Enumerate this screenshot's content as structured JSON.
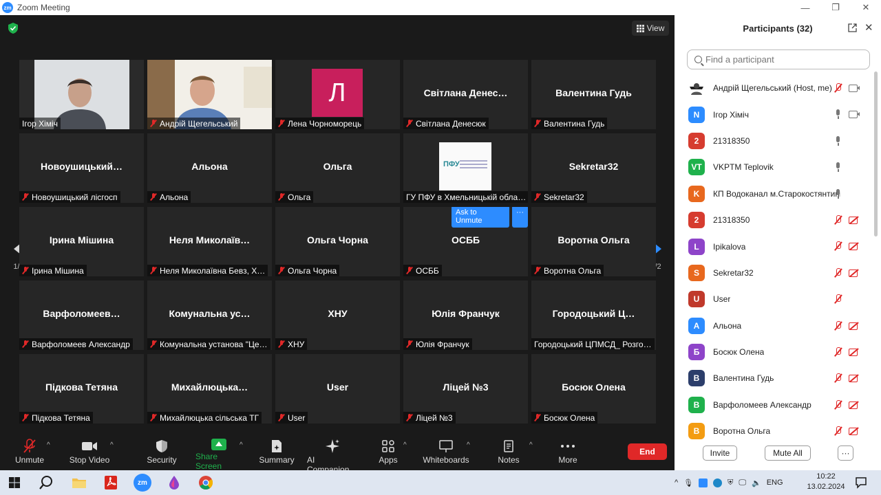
{
  "window": {
    "title": "Zoom Meeting",
    "logo_text": "zm",
    "controls": [
      "—",
      "❐",
      "✕"
    ]
  },
  "meeting": {
    "view_label": "View",
    "page_indicator": "1/2",
    "ask_to_unmute": "Ask to Unmute",
    "more_dots": "···",
    "tiles": [
      {
        "big": "",
        "name": "Ігор Хіміч",
        "kind": "video1",
        "muted": false,
        "active": true
      },
      {
        "big": "",
        "name": "Андрій Щегельський",
        "kind": "video2",
        "muted": true,
        "active": false
      },
      {
        "big": "",
        "name": "Лена Чорноморець",
        "kind": "avatar",
        "avatar": "Л",
        "muted": true
      },
      {
        "big": "Світлана  Денес…",
        "name": "Світлана Денесюк",
        "muted": true
      },
      {
        "big": "Валентина Гудь",
        "name": "Валентина Гудь",
        "muted": true
      },
      {
        "big": "Новоушицький…",
        "name": "Новоушицький лісгосп",
        "muted": true
      },
      {
        "big": "Альона",
        "name": "Альона",
        "muted": true
      },
      {
        "big": "Ольга",
        "name": "Ольга",
        "muted": true
      },
      {
        "big": "",
        "name": "ГУ ПФУ в Хмельницькій обла…",
        "kind": "pfu",
        "logo": "ПФУ",
        "muted": false
      },
      {
        "big": "Sekretar32",
        "name": "Sekretar32",
        "muted": true
      },
      {
        "big": "Ірина Мішина",
        "name": "Ірина Мішина",
        "muted": true
      },
      {
        "big": "Неля  Миколаїв…",
        "name": "Неля Миколаївна Бевз, Х…",
        "muted": true
      },
      {
        "big": "Ольга Чорна",
        "name": "Ольга Чорна",
        "muted": true
      },
      {
        "big": "ОСББ",
        "name": "ОСББ",
        "muted": true,
        "hover": true
      },
      {
        "big": "Воротна Ольга",
        "name": "Воротна Ольга",
        "muted": true
      },
      {
        "big": "Варфоломеев…",
        "name": "Варфоломеев Александр",
        "muted": true
      },
      {
        "big": "Комунальна  ус…",
        "name": "Комунальна установа \"Це…",
        "muted": true
      },
      {
        "big": "ХНУ",
        "name": "ХНУ",
        "muted": true
      },
      {
        "big": "Юлія Франчук",
        "name": "Юлія Франчук",
        "muted": true
      },
      {
        "big": "Городоцький  Ц…",
        "name": "Городоцький ЦПМСД_ Розго…",
        "muted": false
      },
      {
        "big": "Підкова Тетяна",
        "name": "Підкова Тетяна",
        "muted": true
      },
      {
        "big": "Михайлюцька…",
        "name": "Михайлюцька сільська ТГ",
        "muted": true
      },
      {
        "big": "User",
        "name": "User",
        "muted": true
      },
      {
        "big": "Ліцей №3",
        "name": "Ліцей №3",
        "muted": true
      },
      {
        "big": "Босюк Олена",
        "name": "Босюк Олена",
        "muted": true
      }
    ]
  },
  "toolbar": {
    "unmute": "Unmute",
    "stop_video": "Stop Video",
    "security": "Security",
    "share_screen": "Share Screen",
    "summary": "Summary",
    "ai_companion": "AI Companion",
    "apps": "Apps",
    "whiteboards": "Whiteboards",
    "notes": "Notes",
    "more": "More",
    "end": "End",
    "caret": "^",
    "share_color": "#1fb14c",
    "end_color": "#e02828"
  },
  "participants": {
    "title": "Participants (32)",
    "close": "✕",
    "search_placeholder": "Find a participant",
    "invite": "Invite",
    "mute_all": "Mute All",
    "more": "···",
    "list": [
      {
        "initial": "",
        "color": "#ffffff",
        "name": "Андрій Щегельський (Host, me)",
        "mic": "off",
        "cam": "on",
        "photo": true
      },
      {
        "initial": "N",
        "color": "#2d8cff",
        "name": "Ігор Хіміч",
        "mic": "on",
        "cam": "on"
      },
      {
        "initial": "2",
        "color": "#d63c2f",
        "name": "21318350",
        "mic": "on",
        "cam": "none"
      },
      {
        "initial": "VT",
        "color": "#1fb14c",
        "name": "VKPTM Teplovik",
        "mic": "on",
        "cam": "none"
      },
      {
        "initial": "K",
        "color": "#e8681e",
        "name": "КП Водоканал м.Старокостянтинів",
        "mic": "on",
        "cam": "none"
      },
      {
        "initial": "2",
        "color": "#d63c2f",
        "name": "21318350",
        "mic": "off",
        "cam": "off"
      },
      {
        "initial": "L",
        "color": "#8e44c9",
        "name": "Ipikalova",
        "mic": "off",
        "cam": "off"
      },
      {
        "initial": "S",
        "color": "#e8681e",
        "name": "Sekretar32",
        "mic": "off",
        "cam": "off"
      },
      {
        "initial": "U",
        "color": "#c0392b",
        "name": "User",
        "mic": "off",
        "cam": "none"
      },
      {
        "initial": "A",
        "color": "#2d8cff",
        "name": "Альона",
        "mic": "off",
        "cam": "off"
      },
      {
        "initial": "Б",
        "color": "#8e44c9",
        "name": "Босюк Олена",
        "mic": "off",
        "cam": "off"
      },
      {
        "initial": "B",
        "color": "#2c3e6b",
        "name": "Валентина Гудь",
        "mic": "off",
        "cam": "off"
      },
      {
        "initial": "B",
        "color": "#1fb14c",
        "name": "Варфоломеев Александр",
        "mic": "off",
        "cam": "off"
      },
      {
        "initial": "B",
        "color": "#f39c12",
        "name": "Воротна Ольга",
        "mic": "off",
        "cam": "off"
      }
    ]
  },
  "taskbar": {
    "lang": "ENG",
    "time": "10:22",
    "date": "13.02.2024",
    "zoom_label": "zm"
  }
}
